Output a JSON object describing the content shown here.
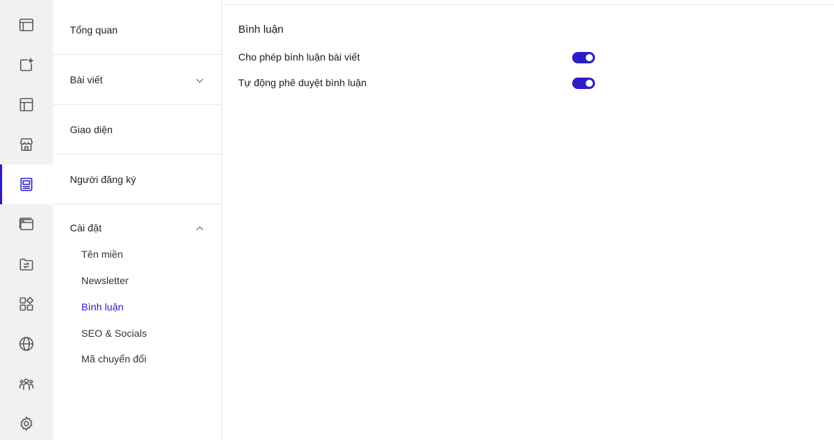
{
  "rail": {
    "items": [
      {
        "icon": "browser-window-icon",
        "active": false
      },
      {
        "icon": "add-post-sparkle-icon",
        "active": false
      },
      {
        "icon": "layout-icon",
        "active": false
      },
      {
        "icon": "store-icon",
        "active": false
      },
      {
        "icon": "blog-newspaper-icon",
        "active": true
      },
      {
        "icon": "browser-tabs-icon",
        "active": false
      },
      {
        "icon": "folder-transfer-icon",
        "active": false
      },
      {
        "icon": "apps-grid-icon",
        "active": false
      },
      {
        "icon": "globe-icon",
        "active": false
      },
      {
        "icon": "users-group-icon",
        "active": false
      },
      {
        "icon": "gear-icon",
        "active": false
      }
    ],
    "accent_color": "#2a1ec8"
  },
  "subnav": {
    "overview": "Tổng quan",
    "posts": "Bài viết",
    "appearance": "Giao diện",
    "subscribers": "Người đăng ký",
    "settings": "Cài đặt",
    "settings_children": [
      {
        "label": "Tên miền",
        "active": false
      },
      {
        "label": "Newsletter",
        "active": false
      },
      {
        "label": "Bình luận",
        "active": true
      },
      {
        "label": "SEO & Socials",
        "active": false
      },
      {
        "label": "Mã chuyển đổi",
        "active": false
      }
    ]
  },
  "main": {
    "title": "Bình luận",
    "settings": [
      {
        "label": "Cho phép bình luận bài viết",
        "enabled": true
      },
      {
        "label": "Tự động phê duyệt bình luận",
        "enabled": true
      }
    ]
  }
}
